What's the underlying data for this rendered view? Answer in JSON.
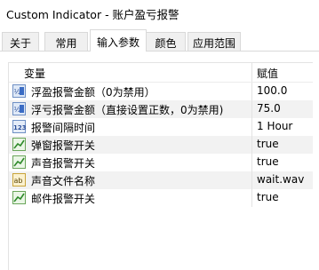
{
  "window": {
    "title": "Custom Indicator - 账户盈亏报警"
  },
  "tabs": [
    {
      "label": "关于"
    },
    {
      "label": "常用"
    },
    {
      "label": "输入参数"
    },
    {
      "label": "颜色"
    },
    {
      "label": "应用范围"
    }
  ],
  "table": {
    "columns": {
      "variable": "变量",
      "value": "赋值"
    },
    "rows": [
      {
        "icon": "numeric-value-icon",
        "name": "浮盈报警金额（0为禁用）",
        "value": "100.0"
      },
      {
        "icon": "numeric-value-icon",
        "name": "浮亏报警金额（直接设置正数，0为禁用)",
        "value": "75.0"
      },
      {
        "icon": "integer-enum-icon",
        "name": "报警间隔时间",
        "value": "1 Hour"
      },
      {
        "icon": "boolean-chart-icon",
        "name": "弹窗报警开关",
        "value": "true"
      },
      {
        "icon": "boolean-chart-icon",
        "name": "声音报警开关",
        "value": "true"
      },
      {
        "icon": "text-string-icon",
        "name": "声音文件名称",
        "value": "wait.wav"
      },
      {
        "icon": "boolean-chart-icon",
        "name": "邮件报警开关",
        "value": "true"
      }
    ]
  }
}
